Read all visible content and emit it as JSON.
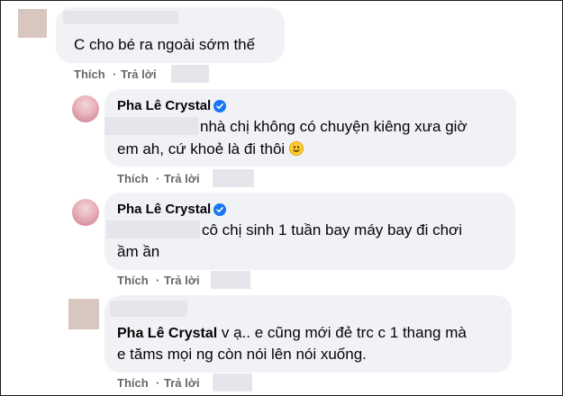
{
  "comments": [
    {
      "text": "C cho bé ra ngoài sớm thế",
      "actions": {
        "like": "Thích",
        "sep": "·",
        "reply": "Trả lời"
      }
    },
    {
      "author": "Pha Lê Crystal",
      "text_line1": "nhà chị không có chuyện kiêng xưa giờ",
      "text_line2": "em ah, cứ khoẻ là đi thôi",
      "emoji": "slightly-smiling-face-icon",
      "actions": {
        "like": "Thích",
        "sep": "·",
        "reply": "Trả lời"
      }
    },
    {
      "author": "Pha Lê Crystal",
      "text_line1": "cô chị sinh 1 tuần bay máy bay đi chơi",
      "text_line2": "ầm ần",
      "actions": {
        "like": "Thích",
        "sep": "·",
        "reply": "Trả lời"
      }
    },
    {
      "mention": "Pha Lê Crystal",
      "text_line1": " v ạ.. e cũng mới đẻ trc c 1 thang mà",
      "text_line2": "e tăms mọi ng còn nói lên nói xuống.",
      "actions": {
        "like": "Thích",
        "sep": "·",
        "reply": "Trả lời"
      }
    }
  ],
  "colors": {
    "bubble": "#f0f2f5",
    "action_text": "#65676b",
    "verified": "#1877f2",
    "frame": "#1c1c1c"
  }
}
